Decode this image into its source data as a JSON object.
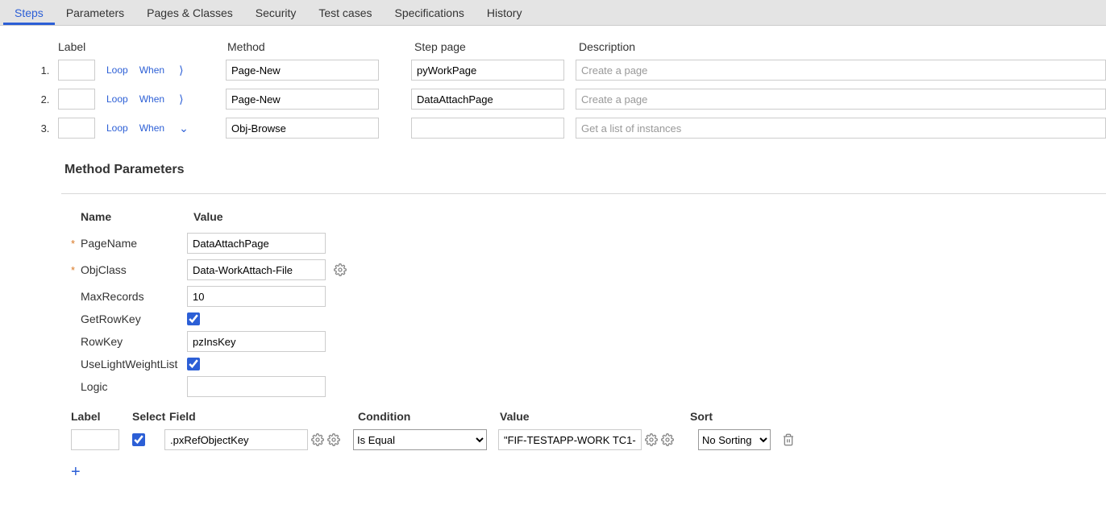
{
  "tabs": {
    "steps": "Steps",
    "parameters": "Parameters",
    "pages_classes": "Pages & Classes",
    "security": "Security",
    "test_cases": "Test cases",
    "specifications": "Specifications",
    "history": "History"
  },
  "steps_header": {
    "label": "Label",
    "method": "Method",
    "step_page": "Step page",
    "description": "Description"
  },
  "steps": [
    {
      "num": "1.",
      "loop": "Loop",
      "when": "When",
      "method": "Page-New",
      "step_page": "pyWorkPage",
      "desc_placeholder": "Create a page"
    },
    {
      "num": "2.",
      "loop": "Loop",
      "when": "When",
      "method": "Page-New",
      "step_page": "DataAttachPage",
      "desc_placeholder": "Create a page"
    },
    {
      "num": "3.",
      "loop": "Loop",
      "when": "When",
      "method": "Obj-Browse",
      "step_page": "",
      "desc_placeholder": "Get a list of instances"
    }
  ],
  "section_title": "Method Parameters",
  "params_header": {
    "name": "Name",
    "value": "Value"
  },
  "params": [
    {
      "required": true,
      "name": "PageName",
      "type": "text",
      "value": "DataAttachPage",
      "gear": false
    },
    {
      "required": true,
      "name": "ObjClass",
      "type": "text",
      "value": "Data-WorkAttach-File",
      "gear": true
    },
    {
      "required": false,
      "name": "MaxRecords",
      "type": "text",
      "value": "10",
      "gear": false
    },
    {
      "required": false,
      "name": "GetRowKey",
      "type": "checkbox",
      "value": true,
      "gear": false
    },
    {
      "required": false,
      "name": "RowKey",
      "type": "text",
      "value": "pzInsKey",
      "gear": false
    },
    {
      "required": false,
      "name": "UseLightWeightList",
      "type": "checkbox",
      "value": true,
      "gear": false
    },
    {
      "required": false,
      "name": "Logic",
      "type": "text",
      "value": "",
      "gear": false
    }
  ],
  "filter_header": {
    "label": "Label",
    "select": "Select",
    "field": "Field",
    "condition": "Condition",
    "value": "Value",
    "sort": "Sort"
  },
  "filter_row": {
    "label": "",
    "select": true,
    "field": ".pxRefObjectKey",
    "condition": "Is Equal",
    "value": "\"FIF-TESTAPP-WORK TC1-",
    "sort": "No Sorting"
  }
}
